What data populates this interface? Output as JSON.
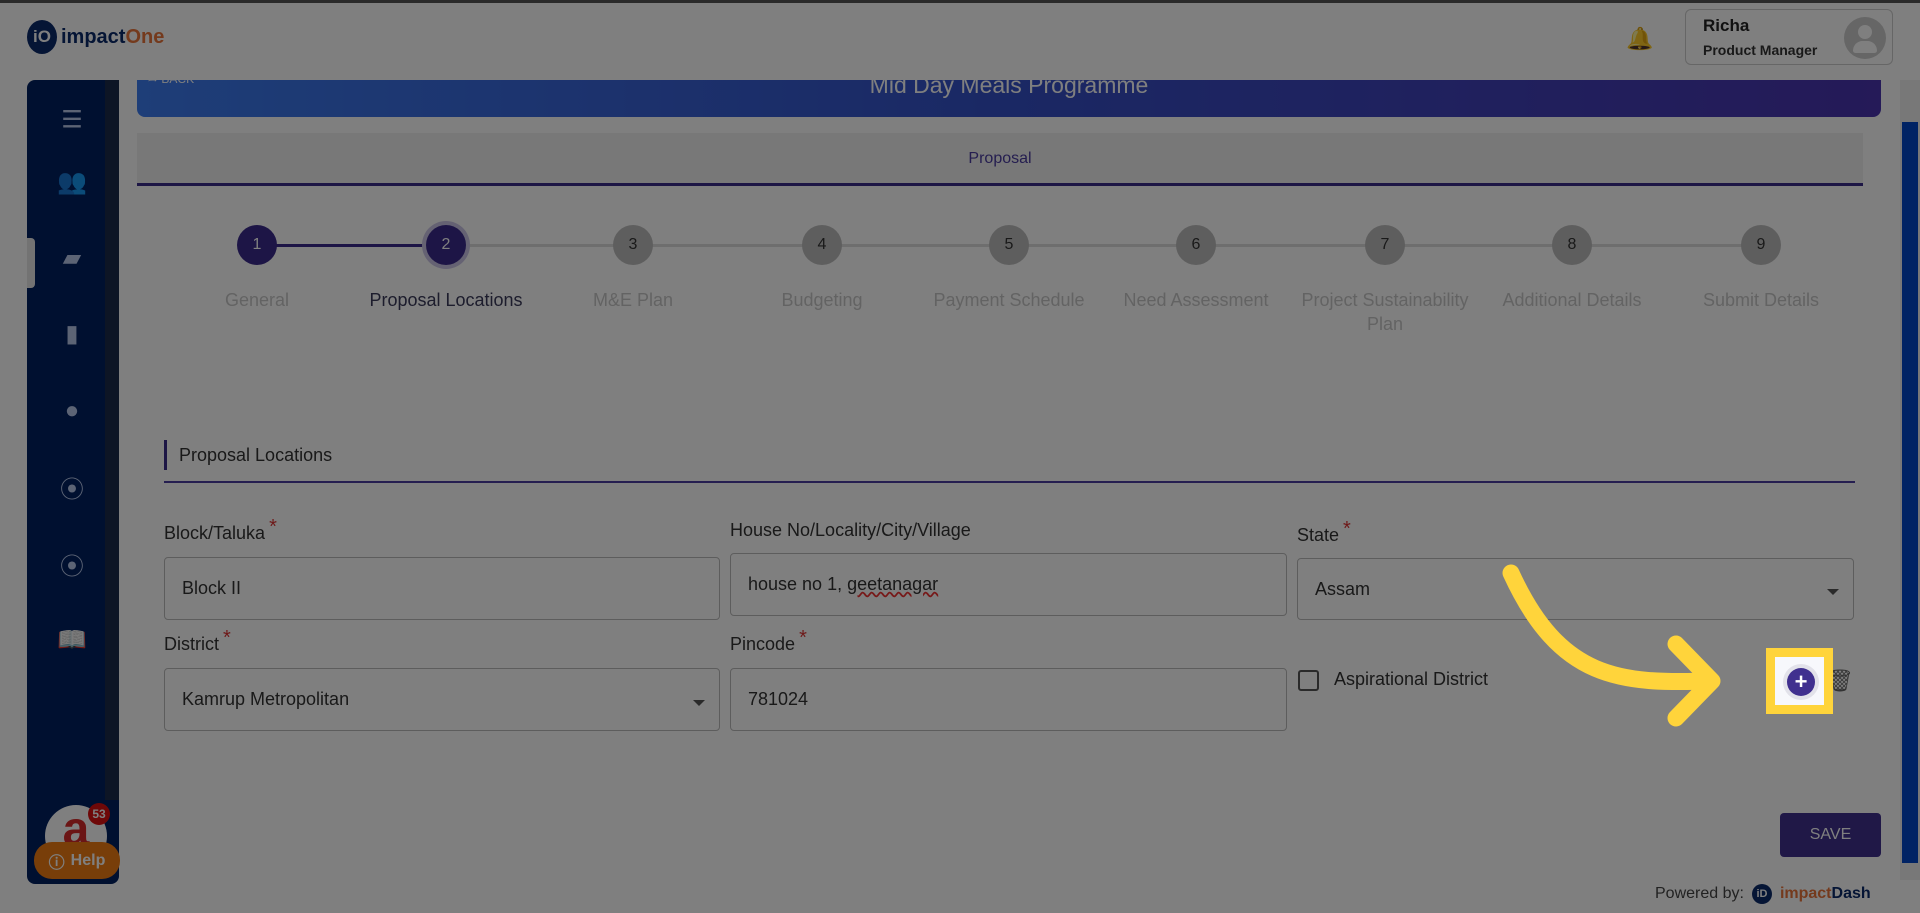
{
  "header": {
    "logo_mark": "iO",
    "logo_text_1": "impact",
    "logo_text_2": "One",
    "user_name": "Richa",
    "user_role": "Product Manager"
  },
  "sidebar": {
    "icons": [
      "menu-icon",
      "users-icon",
      "file-icon",
      "book-icon",
      "person-icon",
      "group-icon",
      "group-icon",
      "open-book-icon"
    ],
    "notification_count": "53",
    "help_label": "Help"
  },
  "banner": {
    "back_label": "BACK",
    "title": "Mid Day Meals Programme"
  },
  "tab": {
    "label": "Proposal"
  },
  "stepper": {
    "current": 2,
    "steps": [
      {
        "num": "1",
        "label": "General"
      },
      {
        "num": "2",
        "label": "Proposal Locations"
      },
      {
        "num": "3",
        "label": "M&E Plan"
      },
      {
        "num": "4",
        "label": "Budgeting"
      },
      {
        "num": "5",
        "label": "Payment Schedule"
      },
      {
        "num": "6",
        "label": "Need Assessment"
      },
      {
        "num": "7",
        "label": "Project Sustainability Plan"
      },
      {
        "num": "8",
        "label": "Additional Details"
      },
      {
        "num": "9",
        "label": "Submit Details"
      }
    ]
  },
  "section": {
    "title": "Proposal Locations"
  },
  "form": {
    "block_label": "Block/Taluka",
    "block_value": "Block II",
    "house_label": "House No/Locality/City/Village",
    "house_value_1": "house no 1, ",
    "house_value_2": "geetanagar",
    "state_label": "State",
    "state_value": "Assam",
    "district_label": "District",
    "district_value": "Kamrup Metropolitan",
    "pincode_label": "Pincode",
    "pincode_value": "781024",
    "aspirational_label": "Aspirational District",
    "aspirational_checked": false,
    "required_mark": "*"
  },
  "actions": {
    "add_label": "+",
    "save_label": "SAVE"
  },
  "footer": {
    "powered_by": "Powered by:",
    "mark": "iD",
    "brand_1": "impact",
    "brand_2": "Dash"
  },
  "colors": {
    "accent": "#40308f",
    "highlight": "#ffd43b",
    "overlay": "rgba(0,0,0,0.5)"
  }
}
